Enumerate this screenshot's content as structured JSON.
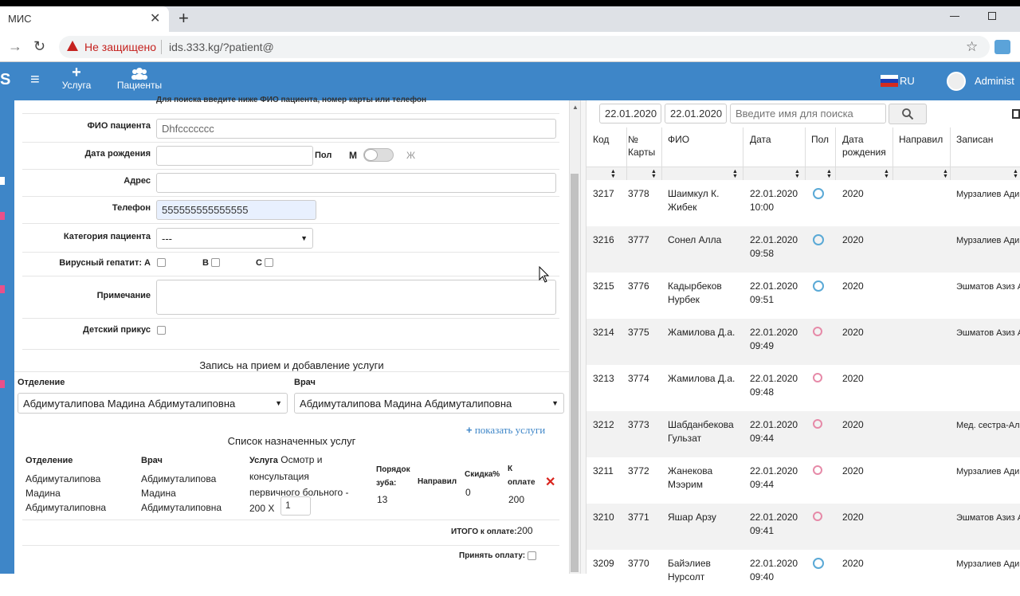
{
  "browser": {
    "tab_title": "МИС",
    "new_tab": "+",
    "tab_close": "✕",
    "security_text": "Не защищено",
    "url": "ids.333.kg/?patient@"
  },
  "navbar": {
    "logo": "S",
    "menu_icon": "≡",
    "service_icon": "+",
    "service_label": "Услуга",
    "patients_label": "Пациенты",
    "lang": "RU",
    "user": "Administ"
  },
  "form": {
    "hint": "Для поиска введите ниже ФИО пациента, номер карты или телефон",
    "fio_label": "ФИО пациента",
    "fio_value": "Dhfccccccc",
    "dob_label": "Дата рождения",
    "dob_value": "",
    "sex_label": "Пол",
    "sex_m": "М",
    "sex_f": "Ж",
    "address_label": "Адрес",
    "address_value": "",
    "phone_label": "Телефон",
    "phone_value": "555555555555555",
    "category_label": "Категория пациента",
    "category_value": "---",
    "hepatitis_label": "Вирусный гепатит: А",
    "hep_b": "В",
    "hep_c": "С",
    "note_label": "Примечание",
    "child_bite_label": "Детский прикус"
  },
  "appointment": {
    "title": "Запись на прием и добавление услуги",
    "department_label": "Отделение",
    "department_value": "Абдимуталипова Мадина Абдимуталиповна",
    "doctor_label": "Врач",
    "doctor_value": "Абдимуталипова Мадина Абдимуталиповна",
    "show_services": "показать услуги",
    "services_title": "Список назначенных услуг",
    "col_department": "Отделение",
    "col_doctor": "Врач",
    "col_service": "Услуга",
    "col_tooth": "Порядок зуба:",
    "col_direction": "Направил",
    "col_discount": "Скидка%",
    "col_topay": "К оплате",
    "row_department": "Абдимуталипова Мадина Абдимуталиповна",
    "row_doctor": "Абдимуталипова Мадина Абдимуталиповна",
    "row_service": "Осмотр и консультация первичного больного - 200 X",
    "row_qty": "1",
    "row_tooth": "13",
    "row_discount": "0",
    "row_topay": "200",
    "total_label": "ИТОГО к оплате:",
    "total_value": "200",
    "accept_label": "Принять оплату:"
  },
  "list": {
    "date_from": "22.01.2020",
    "date_to": "22.01.2020",
    "search_placeholder": "Введите имя для поиска",
    "headers": [
      "Код",
      "№ Карты",
      "ФИО",
      "Дата",
      "Пол",
      "Дата рождения",
      "Направил",
      "Записан"
    ],
    "rows": [
      {
        "code": "3217",
        "card": "3778",
        "fio": "Шаимкул К. Жибек",
        "date": "22.01.2020 10:00",
        "sex": "m",
        "dob": "2020",
        "dir": "",
        "rec": "Мурзалиев Ади"
      },
      {
        "code": "3216",
        "card": "3777",
        "fio": "Сонел Алла",
        "date": "22.01.2020 09:58",
        "sex": "m",
        "dob": "2020",
        "dir": "",
        "rec": "Мурзалиев Ади"
      },
      {
        "code": "3215",
        "card": "3776",
        "fio": "Кадырбеков Нурбек",
        "date": "22.01.2020 09:51",
        "sex": "m",
        "dob": "2020",
        "dir": "",
        "rec": "Эшматов Азиз А"
      },
      {
        "code": "3214",
        "card": "3775",
        "fio": "Жамилова Д.а.",
        "date": "22.01.2020 09:49",
        "sex": "f",
        "dob": "2020",
        "dir": "",
        "rec": "Эшматов Азиз А"
      },
      {
        "code": "3213",
        "card": "3774",
        "fio": "Жамилова Д.а.",
        "date": "22.01.2020 09:48",
        "sex": "f",
        "dob": "2020",
        "dir": "",
        "rec": ""
      },
      {
        "code": "3212",
        "card": "3773",
        "fio": "Шабданбекова Гульзат",
        "date": "22.01.2020 09:44",
        "sex": "f",
        "dob": "2020",
        "dir": "",
        "rec": "Мед. сестра-Ал"
      },
      {
        "code": "3211",
        "card": "3772",
        "fio": "Жанекова Мээрим",
        "date": "22.01.2020 09:44",
        "sex": "f",
        "dob": "2020",
        "dir": "",
        "rec": "Мурзалиев Ади"
      },
      {
        "code": "3210",
        "card": "3771",
        "fio": "Яшар Арзу",
        "date": "22.01.2020 09:41",
        "sex": "f",
        "dob": "2020",
        "dir": "",
        "rec": "Эшматов Азиз А"
      },
      {
        "code": "3209",
        "card": "3770",
        "fio": "Байэлиев Нурсолт",
        "date": "22.01.2020 09:40",
        "sex": "m",
        "dob": "2020",
        "dir": "",
        "rec": "Мурзалиев Ади"
      }
    ]
  }
}
